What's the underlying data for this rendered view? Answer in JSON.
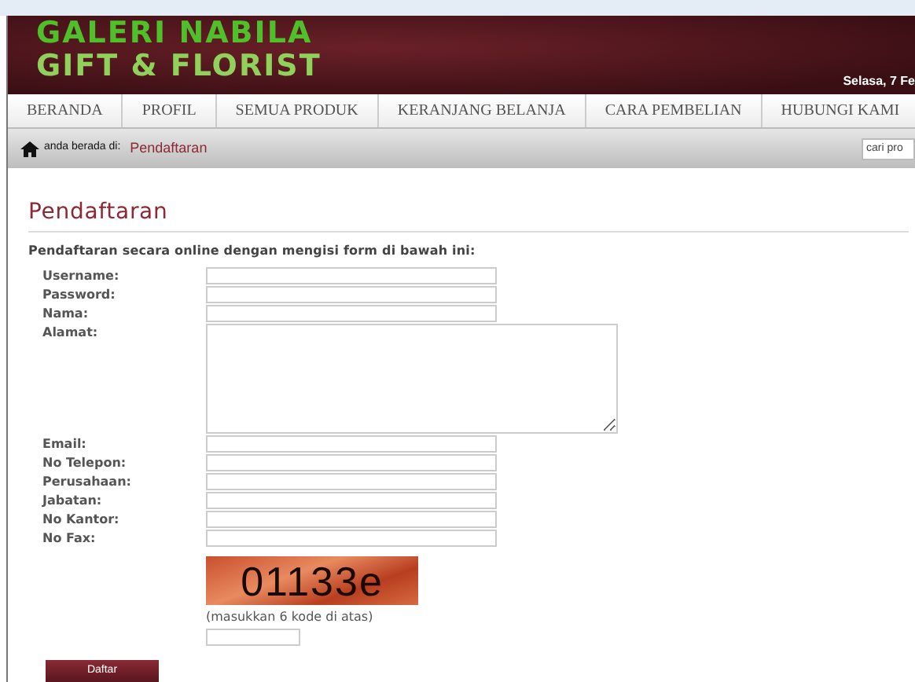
{
  "header": {
    "logo_lines": [
      "GALERI NABILA",
      "GIFT & FLORIST"
    ],
    "date": "Selasa, 7 Fe"
  },
  "nav": [
    {
      "label": "BERANDA"
    },
    {
      "label": "PROFIL"
    },
    {
      "label": "SEMUA PRODUK"
    },
    {
      "label": "KERANJANG BELANJA"
    },
    {
      "label": "CARA PEMBELIAN"
    },
    {
      "label": "HUBUNGI KAMI"
    }
  ],
  "breadcrumb": {
    "prefix": "anda berada di:",
    "current": "Pendaftaran"
  },
  "search": {
    "placeholder": "cari pro"
  },
  "page_title": "Pendaftaran",
  "intro": "Pendaftaran secara online dengan mengisi form di bawah ini:",
  "fields": [
    {
      "label": "Username:",
      "kind": "input"
    },
    {
      "label": "Password:",
      "kind": "input"
    },
    {
      "label": "Nama:",
      "kind": "input"
    },
    {
      "label": "Alamat:",
      "kind": "textarea"
    },
    {
      "label": "Email:",
      "kind": "input"
    },
    {
      "label": "No Telepon:",
      "kind": "input"
    },
    {
      "label": "Perusahaan:",
      "kind": "input"
    },
    {
      "label": "Jabatan:",
      "kind": "input"
    },
    {
      "label": "No Kantor:",
      "kind": "input"
    },
    {
      "label": "No Fax:",
      "kind": "input"
    }
  ],
  "captcha": {
    "code": "01133e",
    "hint": "(masukkan 6 kode di atas)"
  },
  "submit": "Daftar"
}
